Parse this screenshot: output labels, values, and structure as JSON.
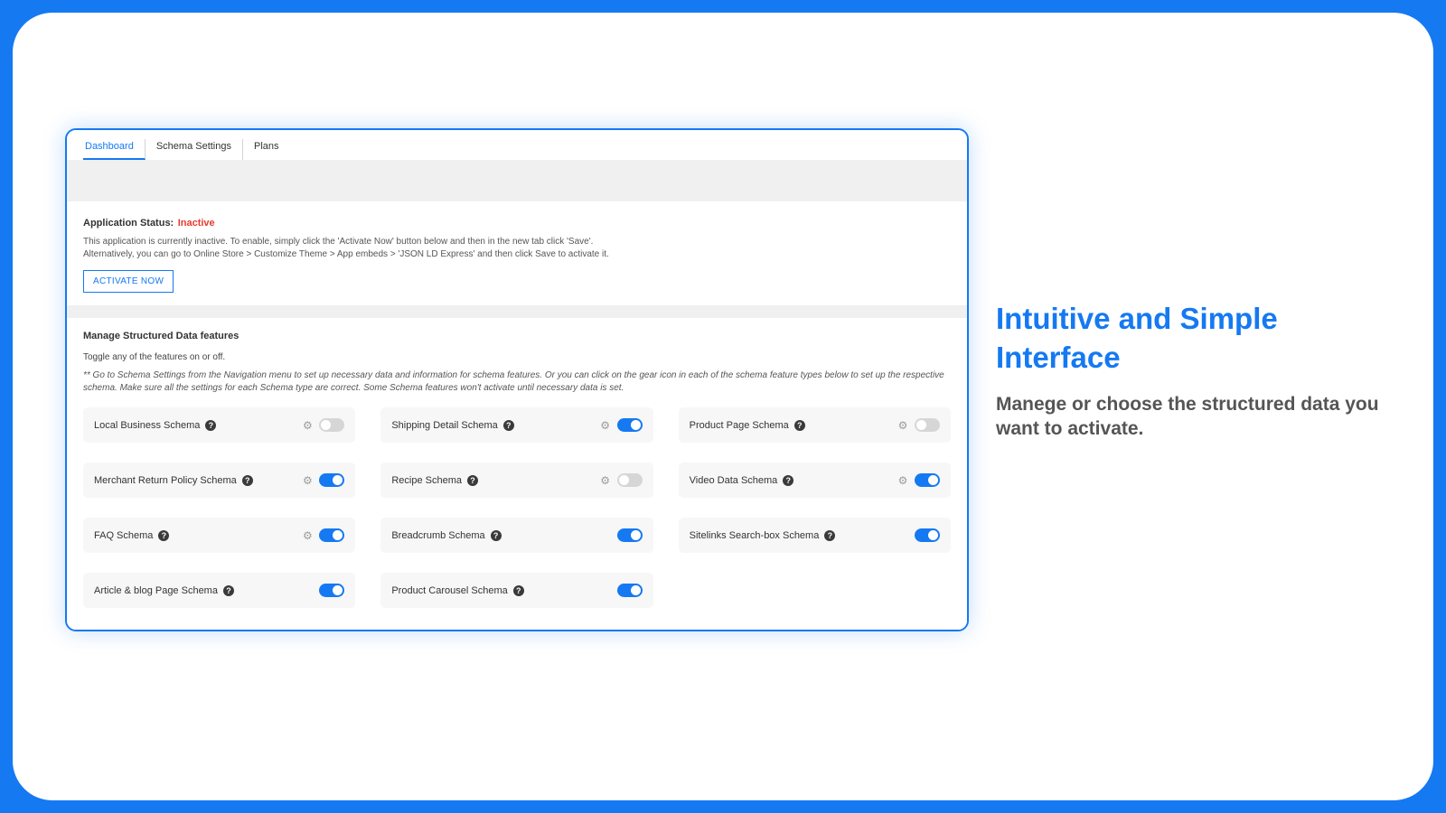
{
  "tabs": {
    "dashboard": "Dashboard",
    "schema_settings": "Schema Settings",
    "plans": "Plans"
  },
  "status": {
    "label": "Application Status:",
    "value": "Inactive",
    "desc1": "This application is currently inactive. To enable, simply click the 'Activate Now' button below and then in the new tab click 'Save'.",
    "desc2": "Alternatively, you can go to Online Store > Customize Theme > App embeds > 'JSON LD Express' and then click Save to activate it.",
    "button": "ACTIVATE NOW"
  },
  "manage": {
    "title": "Manage Structured Data features",
    "subtitle": "Toggle any of the features on or off.",
    "note": "** Go to Schema Settings from the Navigation menu to set up necessary data and information for schema features. Or you can click on the gear icon in each of the schema feature types below to set up the respective schema. Make sure all the settings for each Schema type are correct. Some Schema features won't activate until necessary data is set."
  },
  "cards": {
    "local_business": "Local Business Schema",
    "shipping_detail": "Shipping Detail Schema",
    "product_page": "Product Page Schema",
    "merchant_return": "Merchant Return Policy Schema",
    "recipe": "Recipe Schema",
    "video_data": "Video Data Schema",
    "faq": "FAQ Schema",
    "breadcrumb": "Breadcrumb Schema",
    "sitelinks": "Sitelinks Search-box Schema",
    "article_blog": "Article & blog Page Schema",
    "product_carousel": "Product Carousel Schema"
  },
  "promo": {
    "title": "Intuitive and Simple Interface",
    "subtitle": "Manege or choose the structured data you want to activate."
  }
}
